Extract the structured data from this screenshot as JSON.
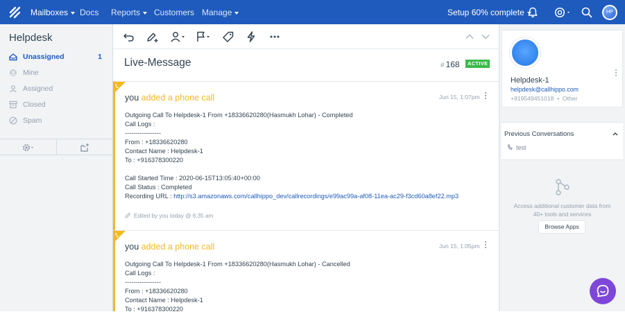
{
  "topbar": {
    "nav": [
      {
        "label": "Mailboxes",
        "has_caret": true
      },
      {
        "label": "Docs",
        "has_caret": false
      },
      {
        "label": "Reports",
        "has_caret": true
      },
      {
        "label": "Customers",
        "has_caret": false
      },
      {
        "label": "Manage",
        "has_caret": true
      }
    ],
    "setup_label": "Setup 60% complete",
    "setup_progress": 0.6,
    "icons": [
      "bell-icon",
      "help-icon",
      "search-icon"
    ],
    "avatar_initials": "HP"
  },
  "sidebar": {
    "title": "Helpdesk",
    "items": [
      {
        "label": "Unassigned",
        "count": "1",
        "icon": "inbox-icon",
        "active": true
      },
      {
        "label": "Mine",
        "icon": "user-circle-icon"
      },
      {
        "label": "Assigned",
        "icon": "person-icon"
      },
      {
        "label": "Closed",
        "icon": "archive-icon"
      },
      {
        "label": "Spam",
        "icon": "slash-icon"
      }
    ],
    "tools": [
      "gear-icon",
      "new-folder-icon"
    ]
  },
  "toolbar": {
    "icons": [
      "undo-icon",
      "edit-icon",
      "assign-icon",
      "flag-icon",
      "tag-icon",
      "workflow-icon",
      "more-icon",
      "up-icon",
      "down-icon"
    ]
  },
  "conversation": {
    "title": "Live-Message",
    "number": "168",
    "status": "ACTIVE",
    "status_color": "#3bb94a",
    "threads": [
      {
        "who": "you",
        "action": "added a phone call",
        "time": "Jun 15, 1:07pm",
        "lines": [
          "Outgoing Call To Helpdesk-1 From +18336620280(Hasmukh Lohar) - Completed",
          "Call Logs :",
          "-----------------",
          "From : +18336620280",
          "Contact Name : Helpdesk-1",
          "To : +916378300220",
          "",
          "Call Started Time : 2020-06-15T13:05:40+00:00",
          "Call Status : Completed",
          "Recording URL : "
        ],
        "recording_url": "http://s3.amazonaws.com/callhippo_dev/callrecordings/e99ac99a-af08-11ea-ac29-f3cd60a8ef22.mp3",
        "edited": "Edited by you today @ 6:35 am"
      },
      {
        "who": "you",
        "action": "added a phone call",
        "time": "Jun 15, 1:05pm",
        "lines": [
          "Outgoing Call To Helpdesk-1 From +18336620280(Hasmukh Lohar) - Cancelled",
          "Call Logs :",
          "-----------------",
          "From : +18336620280",
          "Contact Name : Helpdesk-1",
          "To : +916378300220"
        ]
      }
    ]
  },
  "customer": {
    "name": "Helpdesk-1",
    "email": "helpdesk@callhippo.com",
    "phone": "+919549451018",
    "phone_type": "Other"
  },
  "previous_conversations": {
    "title": "Previous Conversations",
    "items": [
      {
        "label": "test",
        "icon": "phone-icon"
      }
    ]
  },
  "apps": {
    "text": "Access additional customer data from 40+ tools and services",
    "button": "Browse Apps"
  },
  "colors": {
    "brand": "#1f5bbd",
    "accent": "#f5b827",
    "beacon": "#7e47d9"
  }
}
